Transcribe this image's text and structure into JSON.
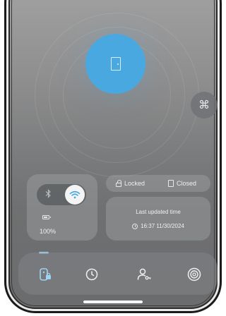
{
  "status": {
    "lock_label": "Locked",
    "door_label": "Closed"
  },
  "device": {
    "battery_percent": "100%",
    "bluetooth_icon": "bluetooth-icon",
    "wifi_icon": "wifi-icon",
    "wifi_active": true
  },
  "update": {
    "title": "Last updated time",
    "time": "16:37 11/30/2024"
  },
  "main": {
    "door_button_icon": "door-icon",
    "command_button_icon": "command-icon",
    "command_glyph": "⌘"
  },
  "nav": {
    "items": [
      {
        "name": "lock-tab",
        "icon": "door-lock-icon",
        "active": true
      },
      {
        "name": "history-tab",
        "icon": "clock-icon",
        "active": false
      },
      {
        "name": "users-tab",
        "icon": "user-key-icon",
        "active": false
      },
      {
        "name": "settings-tab",
        "icon": "settings-icon",
        "active": false
      }
    ]
  },
  "colors": {
    "accent": "#4aa8e0",
    "active_tab": "#9fd3f3"
  }
}
